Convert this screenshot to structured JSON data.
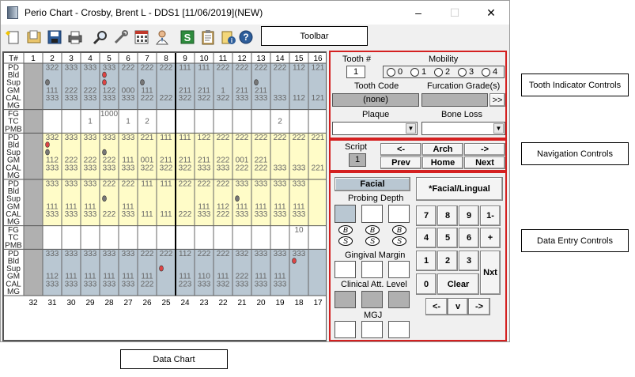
{
  "window": {
    "title": "Perio Chart - Crosby, Brent L - DDS1 [11/06/2019](NEW)",
    "minimize": "–",
    "maximize": "☐",
    "close": "✕"
  },
  "toolbar": {
    "icons": [
      "new-icon",
      "open-icon",
      "save-icon",
      "print-icon",
      "zoom-icon",
      "tools-icon",
      "calculator-icon",
      "doctor-icon",
      "s-icon",
      "clipboard-icon",
      "info-icon",
      "help-icon"
    ]
  },
  "callouts": {
    "toolbar": "Toolbar",
    "tooth_indicator": "Tooth Indicator Controls",
    "navigation": "Navigation Controls",
    "data_entry": "Data Entry Controls",
    "data_chart": "Data Chart"
  },
  "chart": {
    "t_header": "T#",
    "upper_teeth": [
      "1",
      "2",
      "3",
      "4",
      "5",
      "6",
      "7",
      "8",
      "9",
      "10",
      "11",
      "12",
      "13",
      "14",
      "15",
      "16"
    ],
    "lower_teeth": [
      "32",
      "31",
      "30",
      "29",
      "28",
      "27",
      "26",
      "25",
      "24",
      "23",
      "22",
      "21",
      "20",
      "19",
      "18",
      "17"
    ],
    "row_labels_a": [
      "PD",
      "Bld",
      "Sup",
      "GM",
      "CAL",
      "MG"
    ],
    "row_labels_b": [
      "FG",
      "TC",
      "PMB"
    ],
    "block1": {
      "pd": [
        "",
        "322",
        "333",
        "333",
        "333",
        "222",
        "222",
        "222",
        "111",
        "111",
        "222",
        "222",
        "222",
        "222",
        "112",
        "121"
      ],
      "gm": [
        "",
        "111",
        "222",
        "222",
        "122",
        "000",
        "111",
        "",
        "211",
        "211",
        "1",
        "211",
        "211",
        "",
        "",
        ""
      ],
      "cal": [
        "",
        "333",
        "333",
        "333",
        "333",
        "333",
        "222",
        "222",
        "322",
        "322",
        "322",
        "333",
        "333",
        "333",
        "112",
        "121"
      ]
    },
    "block2": {
      "fg": [
        "",
        "",
        "",
        "",
        "1000",
        "",
        "",
        "",
        "",
        "",
        "",
        "",
        "",
        "",
        "",
        ""
      ],
      "tc": [
        "",
        "",
        "",
        "1",
        "",
        "1",
        "2",
        "",
        "",
        "",
        "",
        "",
        "",
        "2",
        "",
        ""
      ],
      "pmb": [
        "",
        "",
        "",
        "",
        "",
        "",
        "",
        "",
        "",
        "",
        "",
        "",
        "",
        "",
        "",
        ""
      ]
    },
    "block3": {
      "pd": [
        "",
        "332",
        "333",
        "333",
        "333",
        "333",
        "221",
        "111",
        "111",
        "122",
        "222",
        "222",
        "222",
        "222",
        "222",
        "221"
      ],
      "gm": [
        "",
        "112",
        "222",
        "222",
        "222",
        "111",
        "001",
        "211",
        "211",
        "211",
        "222",
        "001",
        "221",
        "",
        "",
        ""
      ],
      "cal": [
        "",
        "333",
        "333",
        "333",
        "333",
        "333",
        "322",
        "322",
        "322",
        "333",
        "333",
        "222",
        "222",
        "333",
        "333",
        "221"
      ]
    },
    "block4": {
      "pd": [
        "",
        "333",
        "333",
        "333",
        "222",
        "222",
        "111",
        "111",
        "222",
        "222",
        "222",
        "333",
        "333",
        "333",
        "333",
        ""
      ],
      "gm": [
        "",
        "111",
        "111",
        "111",
        "",
        "111",
        "",
        "",
        "",
        "111",
        "112",
        "111",
        "111",
        "111",
        "111",
        ""
      ],
      "cal": [
        "",
        "333",
        "333",
        "333",
        "222",
        "333",
        "111",
        "111",
        "222",
        "333",
        "222",
        "333",
        "333",
        "333",
        "333",
        ""
      ]
    },
    "block5": {
      "fg": [
        "",
        "",
        "",
        "",
        "",
        "",
        "",
        "",
        "",
        "",
        "",
        "",
        "",
        "",
        "10",
        ""
      ],
      "tc": [
        "",
        "",
        "",
        "",
        "",
        "",
        "",
        "",
        "",
        "",
        "",
        "",
        "",
        "",
        "",
        ""
      ],
      "pmb": [
        "",
        "",
        "",
        "",
        "",
        "",
        "",
        "",
        "",
        "",
        "",
        "",
        "",
        "",
        "",
        ""
      ]
    },
    "block6": {
      "pd": [
        "",
        "333",
        "333",
        "333",
        "333",
        "333",
        "222",
        "222",
        "112",
        "222",
        "222",
        "332",
        "333",
        "333",
        "333",
        ""
      ],
      "gm": [
        "",
        "112",
        "111",
        "111",
        "111",
        "111",
        "111",
        "",
        "111",
        "110",
        "111",
        "222",
        "111",
        "111",
        "",
        ""
      ],
      "cal": [
        "",
        "333",
        "333",
        "333",
        "333",
        "333",
        "222",
        "",
        "223",
        "333",
        "332",
        "333",
        "333",
        "333",
        "",
        ""
      ]
    }
  },
  "tooth_panel": {
    "tooth_label": "Tooth #",
    "tooth_value": "1",
    "mobility_label": "Mobility",
    "mobility_options": [
      "0",
      "1",
      "2",
      "3",
      "4"
    ],
    "tooth_code_label": "Tooth Code",
    "tooth_code_value": "(none)",
    "furcation_label": "Furcation Grade(s)",
    "furcation_btn": ">>",
    "plaque_label": "Plaque",
    "bone_loss_label": "Bone Loss"
  },
  "nav_panel": {
    "script_label": "Script",
    "script_value": "1",
    "left_arrow": "<-",
    "arch": "Arch",
    "right_arrow": "->",
    "prev": "Prev",
    "home": "Home",
    "next": "Next"
  },
  "entry_panel": {
    "facial": "Facial",
    "facial_lingual": "*Facial/Lingual",
    "probing_depth": "Probing Depth",
    "gingival_margin": "Gingival Margin",
    "cal": "Clinical Att. Level",
    "mgj": "MGJ",
    "b": "B",
    "s": "S",
    "keys": [
      "7",
      "8",
      "9",
      "1-",
      "4",
      "5",
      "6",
      "+",
      "1",
      "2",
      "3",
      "0"
    ],
    "clear": "Clear",
    "nxt": "Nxt",
    "arrow_left": "<-",
    "arrow_down": "v",
    "arrow_right": "->"
  }
}
